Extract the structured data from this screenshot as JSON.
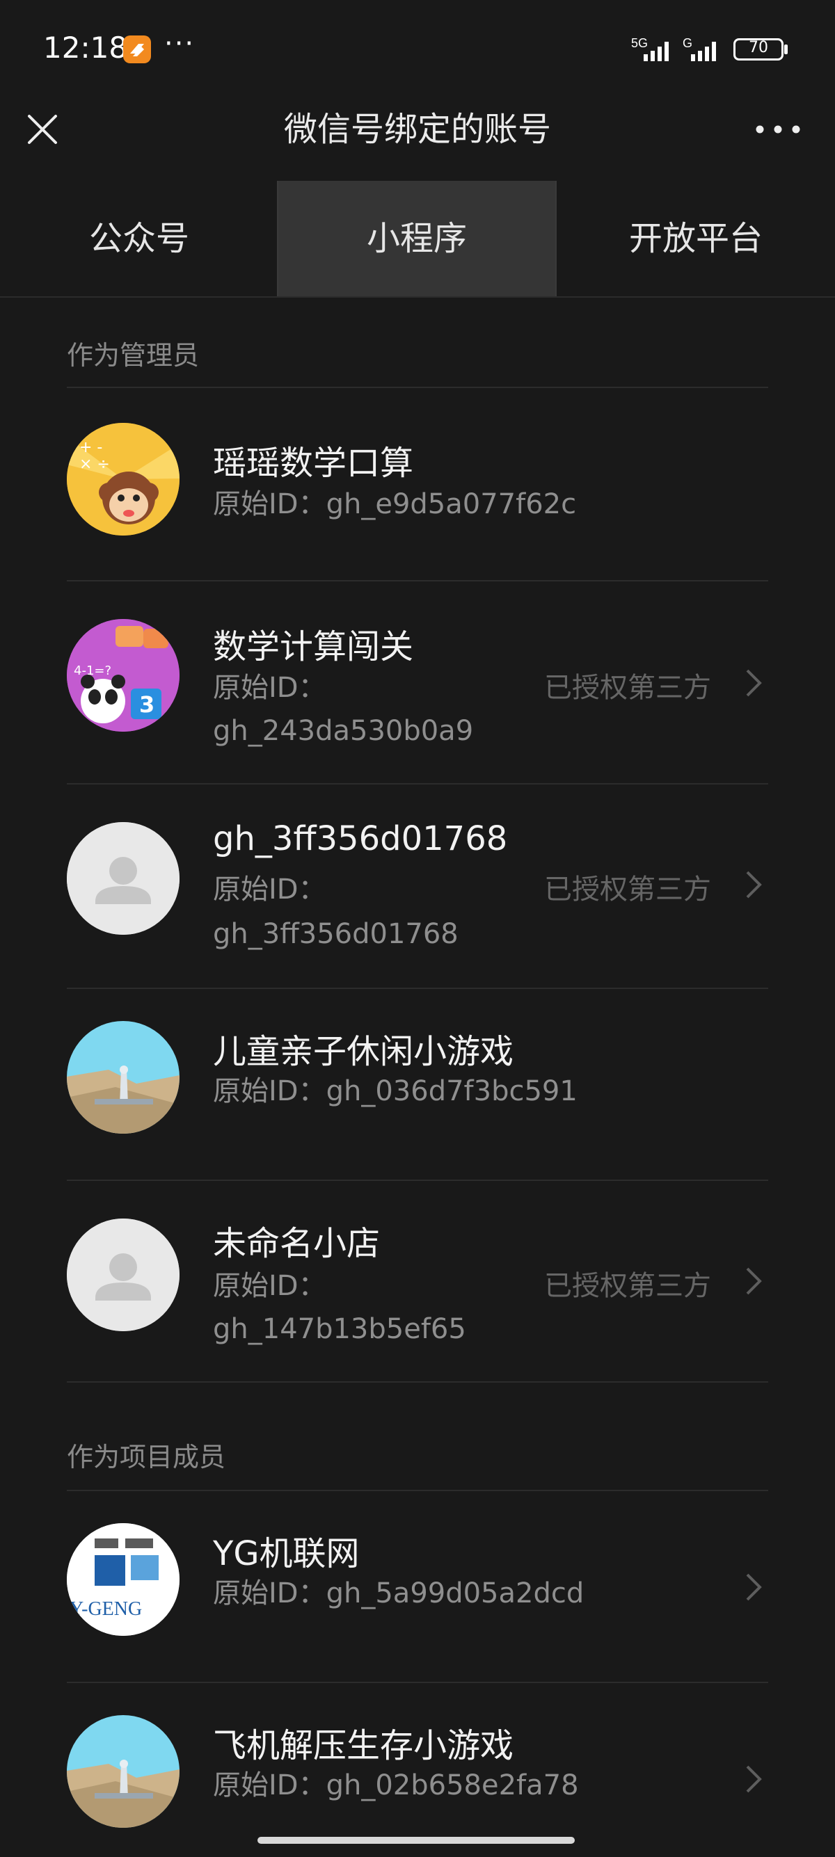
{
  "status_bar": {
    "time": "12:18",
    "network_1": "5G",
    "network_2": "G",
    "battery": "70"
  },
  "nav": {
    "title": "微信号绑定的账号"
  },
  "tabs": [
    {
      "label": "公众号",
      "active": false
    },
    {
      "label": "小程序",
      "active": true
    },
    {
      "label": "开放平台",
      "active": false
    }
  ],
  "sections": [
    {
      "title": "作为管理员",
      "items": [
        {
          "name": "瑶瑶数学口算",
          "id_label": "原始ID：",
          "id": "gh_e9d5a077f62c",
          "status": "",
          "avatar": "monkey-math-icon"
        },
        {
          "name": "数学计算闯关",
          "id_label": "原始ID：",
          "id": "gh_243da530b0a9",
          "status": "已授权第三方",
          "avatar": "panda-math-icon"
        },
        {
          "name": "gh_3ff356d01768",
          "id_label": "原始ID：",
          "id": "gh_3ff356d01768",
          "status": "已授权第三方",
          "avatar": "default-person-icon"
        },
        {
          "name": "儿童亲子休闲小游戏",
          "id_label": "原始ID：",
          "id": "gh_036d7f3bc591",
          "status": "",
          "avatar": "airplane-icon"
        },
        {
          "name": "未命名小店",
          "id_label": "原始ID：",
          "id": "gh_147b13b5ef65",
          "status": "已授权第三方",
          "avatar": "default-person-icon"
        }
      ]
    },
    {
      "title": "作为项目成员",
      "items": [
        {
          "name": "YG机联网",
          "id_label": "原始ID：",
          "id": "gh_5a99d05a2dcd",
          "status": "",
          "avatar": "yg-logo-icon",
          "logo_text": "Y-GENG"
        },
        {
          "name": "飞机解压生存小游戏",
          "id_label": "原始ID：",
          "id": "gh_02b658e2fa78",
          "status": "",
          "avatar": "airplane-icon"
        }
      ]
    }
  ],
  "colors": {
    "background": "#191919",
    "active_tab": "#353535",
    "muted_text": "#8f8f8f"
  }
}
